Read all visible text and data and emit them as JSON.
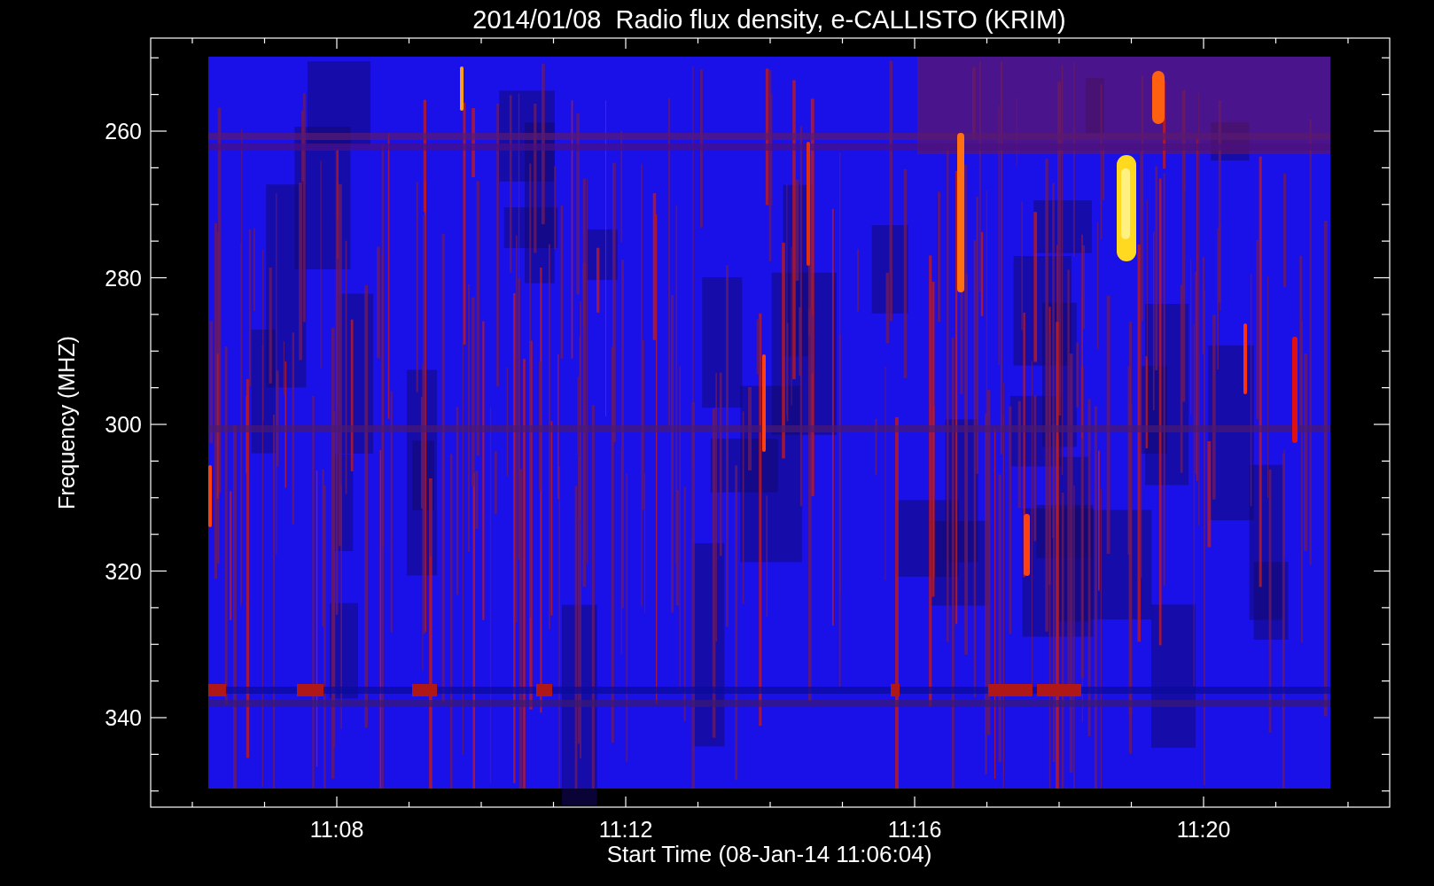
{
  "title": "2014/01/08  Radio flux density, e-CALLISTO (KRIM)",
  "y_axis": {
    "label": "Frequency (MHZ)",
    "ticks": [
      "260",
      "280",
      "300",
      "320",
      "340"
    ]
  },
  "x_axis": {
    "label": "Start Time (08-Jan-14 11:06:04)",
    "ticks": [
      "11:08",
      "11:12",
      "11:16",
      "11:20"
    ]
  }
}
